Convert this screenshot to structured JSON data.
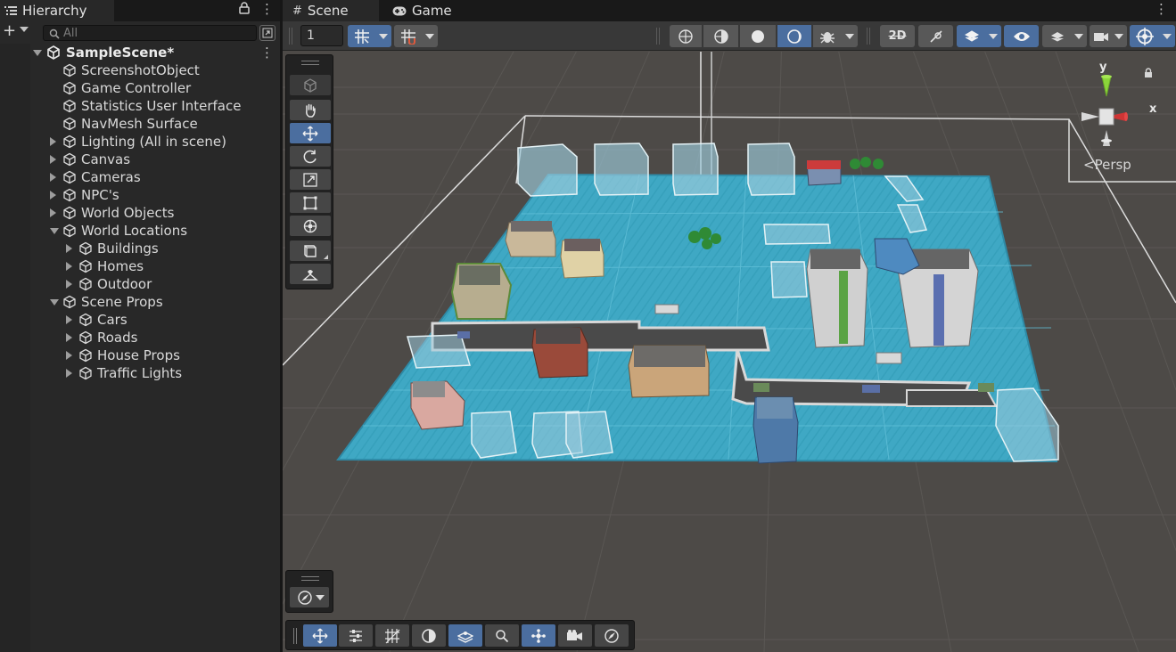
{
  "hierarchy": {
    "tab_label": "Hierarchy",
    "search_placeholder": "All",
    "scene_name": "SampleScene*",
    "items": [
      {
        "label": "ScreenshotObject",
        "depth": 1,
        "expand": "none"
      },
      {
        "label": "Game Controller",
        "depth": 1,
        "expand": "none"
      },
      {
        "label": "Statistics User Interface",
        "depth": 1,
        "expand": "none"
      },
      {
        "label": "NavMesh Surface",
        "depth": 1,
        "expand": "none"
      },
      {
        "label": "Lighting (All in scene)",
        "depth": 1,
        "expand": "collapsed"
      },
      {
        "label": "Canvas",
        "depth": 1,
        "expand": "collapsed"
      },
      {
        "label": "Cameras",
        "depth": 1,
        "expand": "collapsed"
      },
      {
        "label": "NPC's",
        "depth": 1,
        "expand": "collapsed"
      },
      {
        "label": "World Objects",
        "depth": 1,
        "expand": "collapsed"
      },
      {
        "label": "World Locations",
        "depth": 1,
        "expand": "expanded"
      },
      {
        "label": "Buildings",
        "depth": 2,
        "expand": "collapsed"
      },
      {
        "label": "Homes",
        "depth": 2,
        "expand": "collapsed"
      },
      {
        "label": "Outdoor",
        "depth": 2,
        "expand": "collapsed"
      },
      {
        "label": "Scene Props",
        "depth": 1,
        "expand": "expanded"
      },
      {
        "label": "Cars",
        "depth": 2,
        "expand": "collapsed"
      },
      {
        "label": "Roads",
        "depth": 2,
        "expand": "collapsed"
      },
      {
        "label": "House Props",
        "depth": 2,
        "expand": "collapsed"
      },
      {
        "label": "Traffic Lights",
        "depth": 2,
        "expand": "collapsed"
      }
    ]
  },
  "scene_view": {
    "tabs": [
      "Scene",
      "Game"
    ],
    "active_tab": "Scene",
    "grid_size": "1",
    "projection_label": "Persp",
    "gizmo_axes": {
      "y": "y",
      "x": "x"
    }
  },
  "colors": {
    "accent": "#4b6e9f",
    "panel_bg": "#282828",
    "viewport_bg": "#4d4a47",
    "navmesh": "#3aa7c4"
  }
}
